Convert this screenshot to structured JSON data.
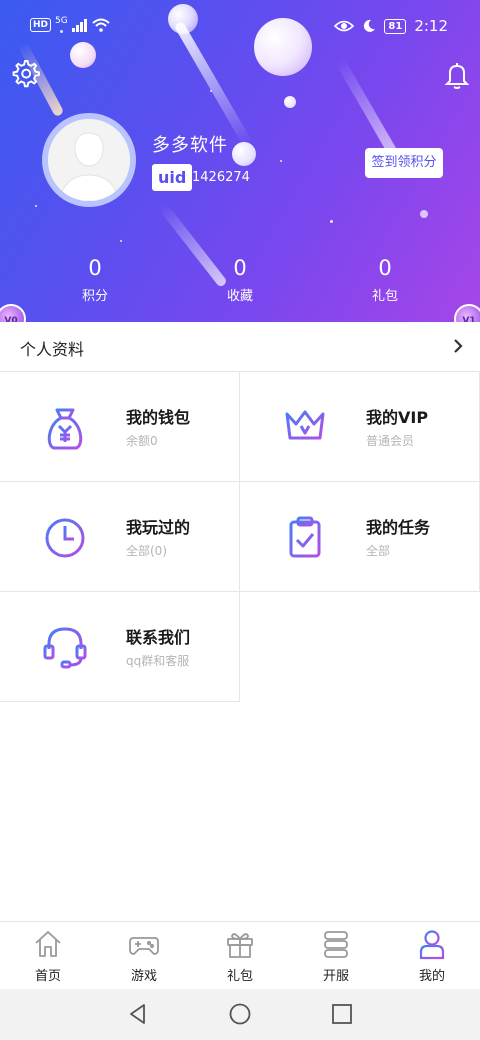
{
  "status_bar": {
    "hd": "HD",
    "net": "5G",
    "battery": "81",
    "time": "2:12"
  },
  "header": {
    "username": "多多软件",
    "uid_label": "uid",
    "uid_value": "1426274",
    "checkin_label": "签到领积分",
    "stats": [
      {
        "value": "0",
        "label": "积分"
      },
      {
        "value": "0",
        "label": "收藏"
      },
      {
        "value": "0",
        "label": "礼包"
      }
    ],
    "level_left": "V0",
    "level_right": "V1"
  },
  "profile_row": {
    "label": "个人资料"
  },
  "tiles": [
    {
      "title": "我的钱包",
      "subtitle": "余额0",
      "icon": "money-bag-icon"
    },
    {
      "title": "我的VIP",
      "subtitle": "普通会员",
      "icon": "crown-icon"
    },
    {
      "title": "我玩过的",
      "subtitle": "全部(0)",
      "icon": "clock-icon"
    },
    {
      "title": "我的任务",
      "subtitle": "全部",
      "icon": "clipboard-check-icon"
    },
    {
      "title": "联系我们",
      "subtitle": "qq群和客服",
      "icon": "headset-icon"
    }
  ],
  "bottom_nav": [
    {
      "label": "首页",
      "icon": "home-icon"
    },
    {
      "label": "游戏",
      "icon": "gamepad-icon"
    },
    {
      "label": "礼包",
      "icon": "gift-icon"
    },
    {
      "label": "开服",
      "icon": "server-icon"
    },
    {
      "label": "我的",
      "icon": "person-icon",
      "active": true
    }
  ],
  "colors": {
    "accent": "#6a4cf0",
    "icon_gradient_start": "#4a7cf5",
    "icon_gradient_end": "#b24ee6"
  }
}
